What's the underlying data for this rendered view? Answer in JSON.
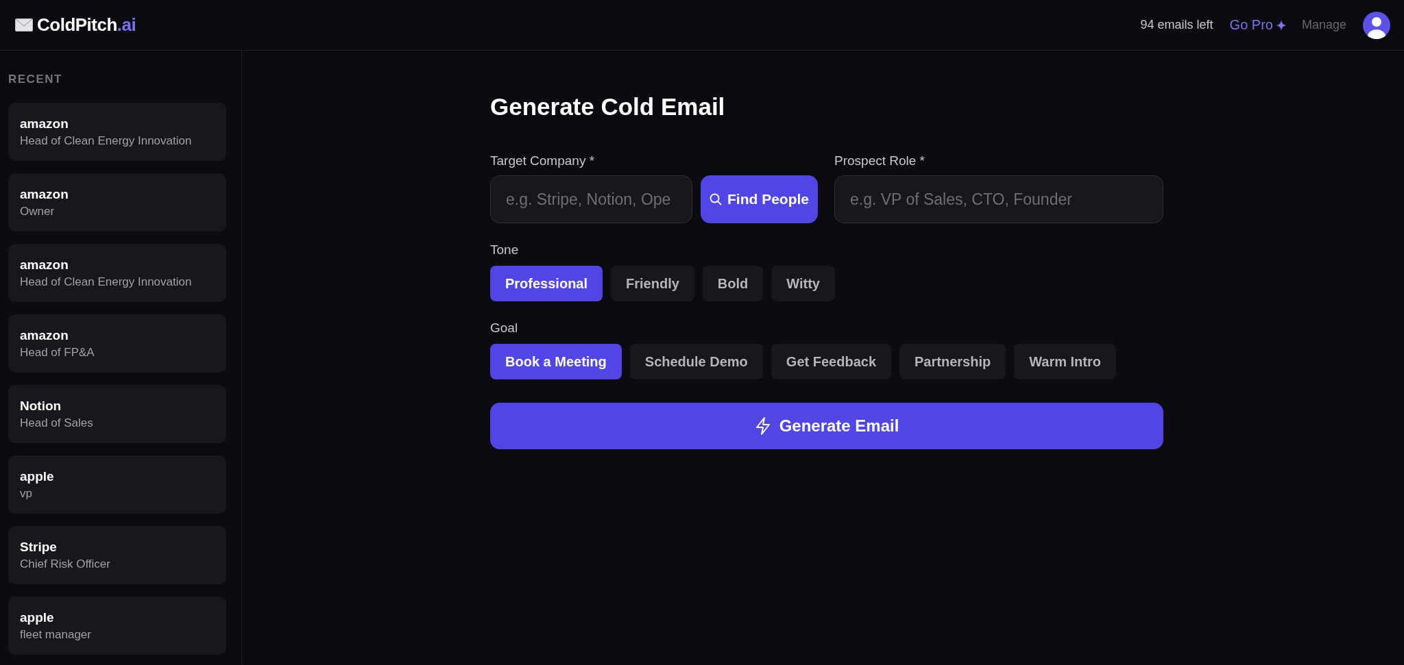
{
  "header": {
    "logo": {
      "name": "ColdPitch",
      "suffix": ".ai"
    },
    "credits": "94 emails left",
    "upgrade": "Go Pro",
    "manage": "Manage"
  },
  "sidebar": {
    "heading": "RECENT",
    "items": [
      {
        "company": "amazon",
        "role": "Head of Clean Energy Innovation"
      },
      {
        "company": "amazon",
        "role": "Owner"
      },
      {
        "company": "amazon",
        "role": "Head of Clean Energy Innovation"
      },
      {
        "company": "amazon",
        "role": "Head of FP&A"
      },
      {
        "company": "Notion",
        "role": "Head of Sales"
      },
      {
        "company": "apple",
        "role": "vp"
      },
      {
        "company": "Stripe",
        "role": "Chief Risk Officer"
      },
      {
        "company": "apple",
        "role": "fleet manager"
      }
    ]
  },
  "form": {
    "title": "Generate Cold Email",
    "company": {
      "label": "Target Company *",
      "placeholder": "e.g. Stripe, Notion, Ope"
    },
    "find_button": "Find People",
    "role": {
      "label": "Prospect Role *",
      "placeholder": "e.g. VP of Sales, CTO, Founder"
    },
    "tone": {
      "label": "Tone",
      "options": [
        {
          "label": "Professional",
          "selected": true
        },
        {
          "label": "Friendly",
          "selected": false
        },
        {
          "label": "Bold",
          "selected": false
        },
        {
          "label": "Witty",
          "selected": false
        }
      ]
    },
    "goal": {
      "label": "Goal",
      "options": [
        {
          "label": "Book a Meeting",
          "selected": true
        },
        {
          "label": "Schedule Demo",
          "selected": false
        },
        {
          "label": "Get Feedback",
          "selected": false
        },
        {
          "label": "Partnership",
          "selected": false
        },
        {
          "label": "Warm Intro",
          "selected": false
        }
      ]
    },
    "submit": "Generate Email"
  }
}
